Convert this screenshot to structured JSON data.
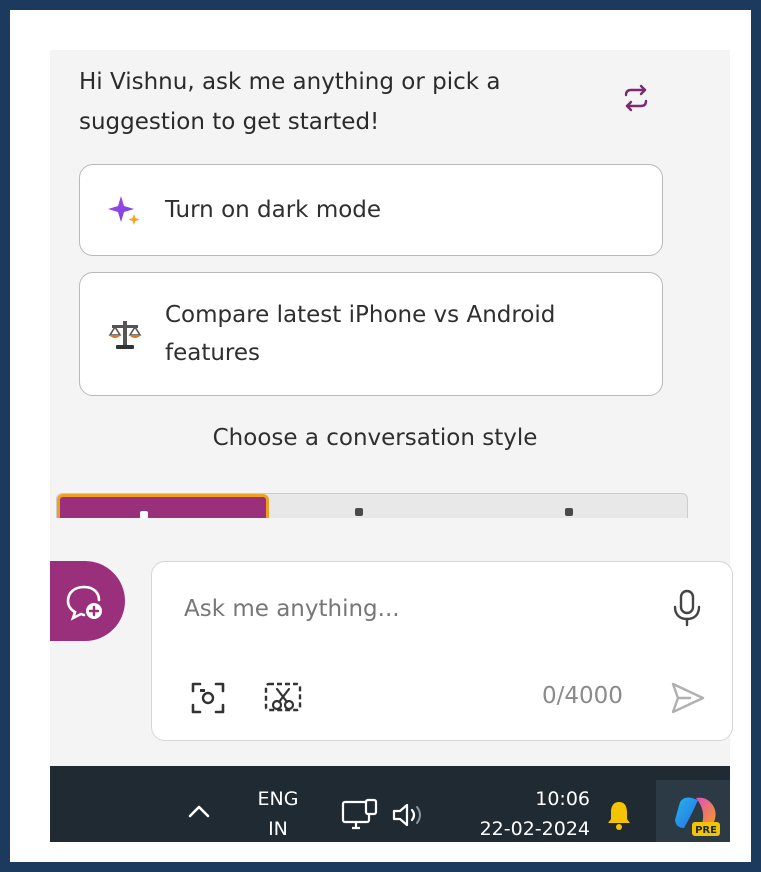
{
  "greeting": {
    "line1": "Hi Vishnu, ask me anything or pick a",
    "line2": "suggestion to get started!",
    "refresh_icon": "refresh-arrows-icon"
  },
  "suggestions": [
    {
      "icon": "sparkle-icon",
      "line1": "Turn on dark mode",
      "line2": ""
    },
    {
      "icon": "balance-scale-icon",
      "line1": "Compare latest iPhone vs Android",
      "line2": "features"
    }
  ],
  "conversation_style": {
    "heading": "Choose a conversation style",
    "active_color": "#9a2f7c",
    "active_border": "#f0a020"
  },
  "composer": {
    "placeholder": "Ask me anything...",
    "counter": "0/4000",
    "icons": [
      "new-topic-icon",
      "microphone-icon",
      "camera-icon",
      "snip-icon",
      "send-icon"
    ]
  },
  "taskbar": {
    "lang_line1": "ENG",
    "lang_line2": "IN",
    "time": "10:06",
    "date": "22-02-2024",
    "icons": [
      "chevron-up-icon",
      "network-icon",
      "volume-icon",
      "bell-icon",
      "copilot-icon"
    ],
    "copilot_badge": "PRE"
  },
  "colors": {
    "accent": "#9a2f7c",
    "taskbar": "#1f2a33",
    "bell": "#f5c400"
  }
}
